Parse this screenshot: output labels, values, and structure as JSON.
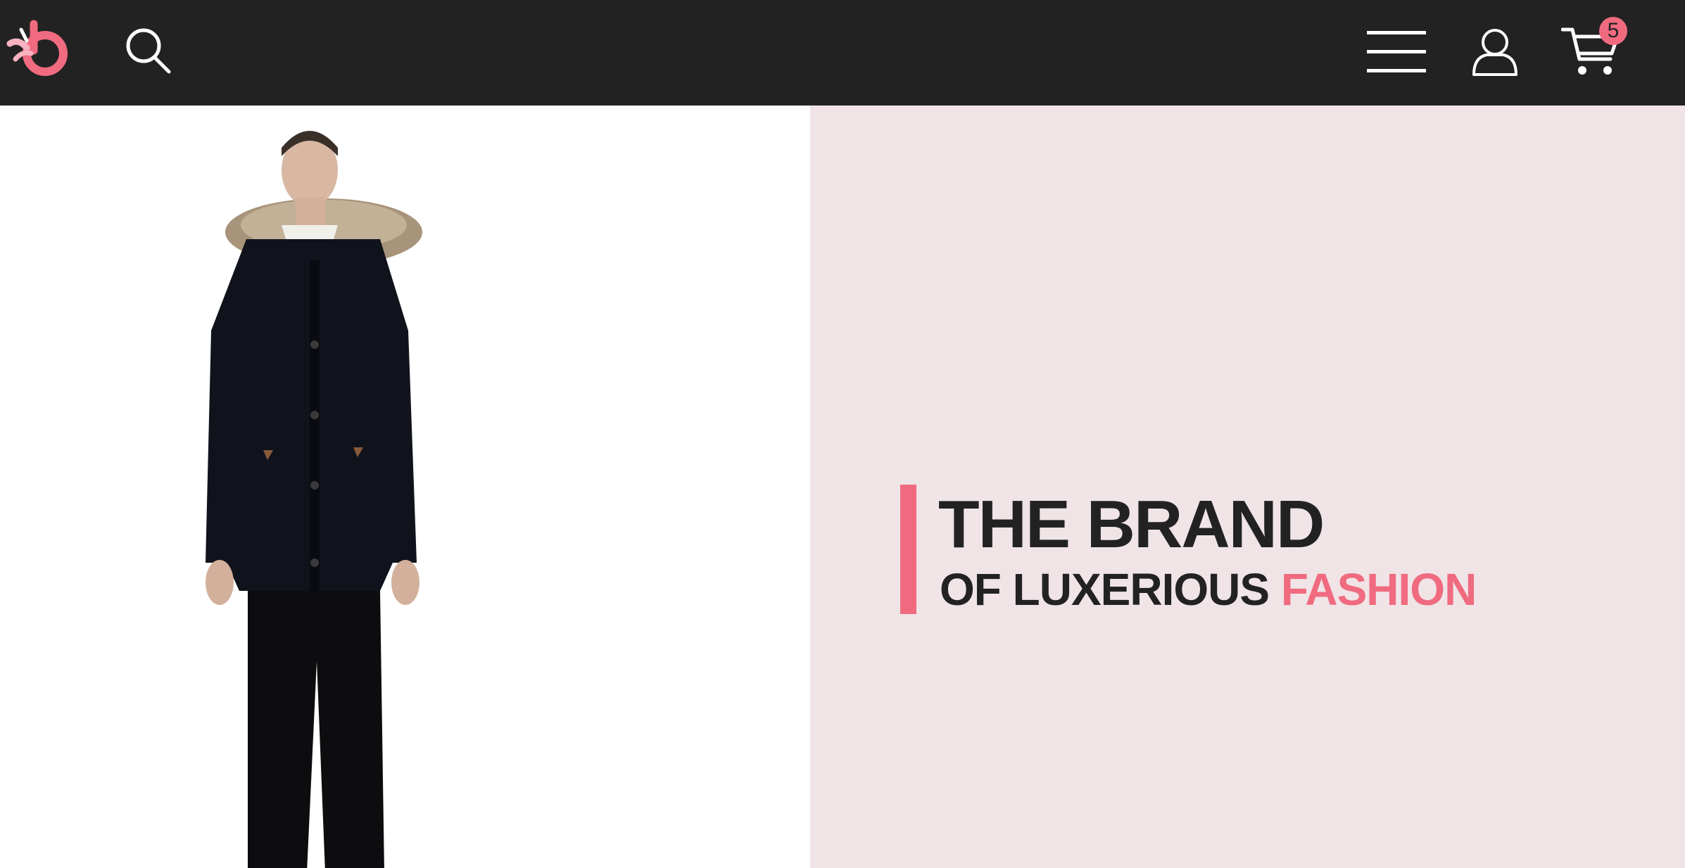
{
  "header": {
    "logo_icon": "brand-logo-icon",
    "search_icon": "search-icon",
    "menu_icon": "hamburger-menu-icon",
    "account_icon": "user-account-icon",
    "cart_icon": "shopping-cart-icon",
    "cart_count": "5"
  },
  "hero": {
    "image_description_icon": "model-photo",
    "headline": "THE BRAND",
    "subhead_prefix": "OF LUXERIOUS ",
    "subhead_accent": "FASHION"
  },
  "colors": {
    "header_bg": "#222222",
    "accent": "#f06b7f",
    "hero_right_bg": "#f0e4e7",
    "text_dark": "#222222"
  }
}
